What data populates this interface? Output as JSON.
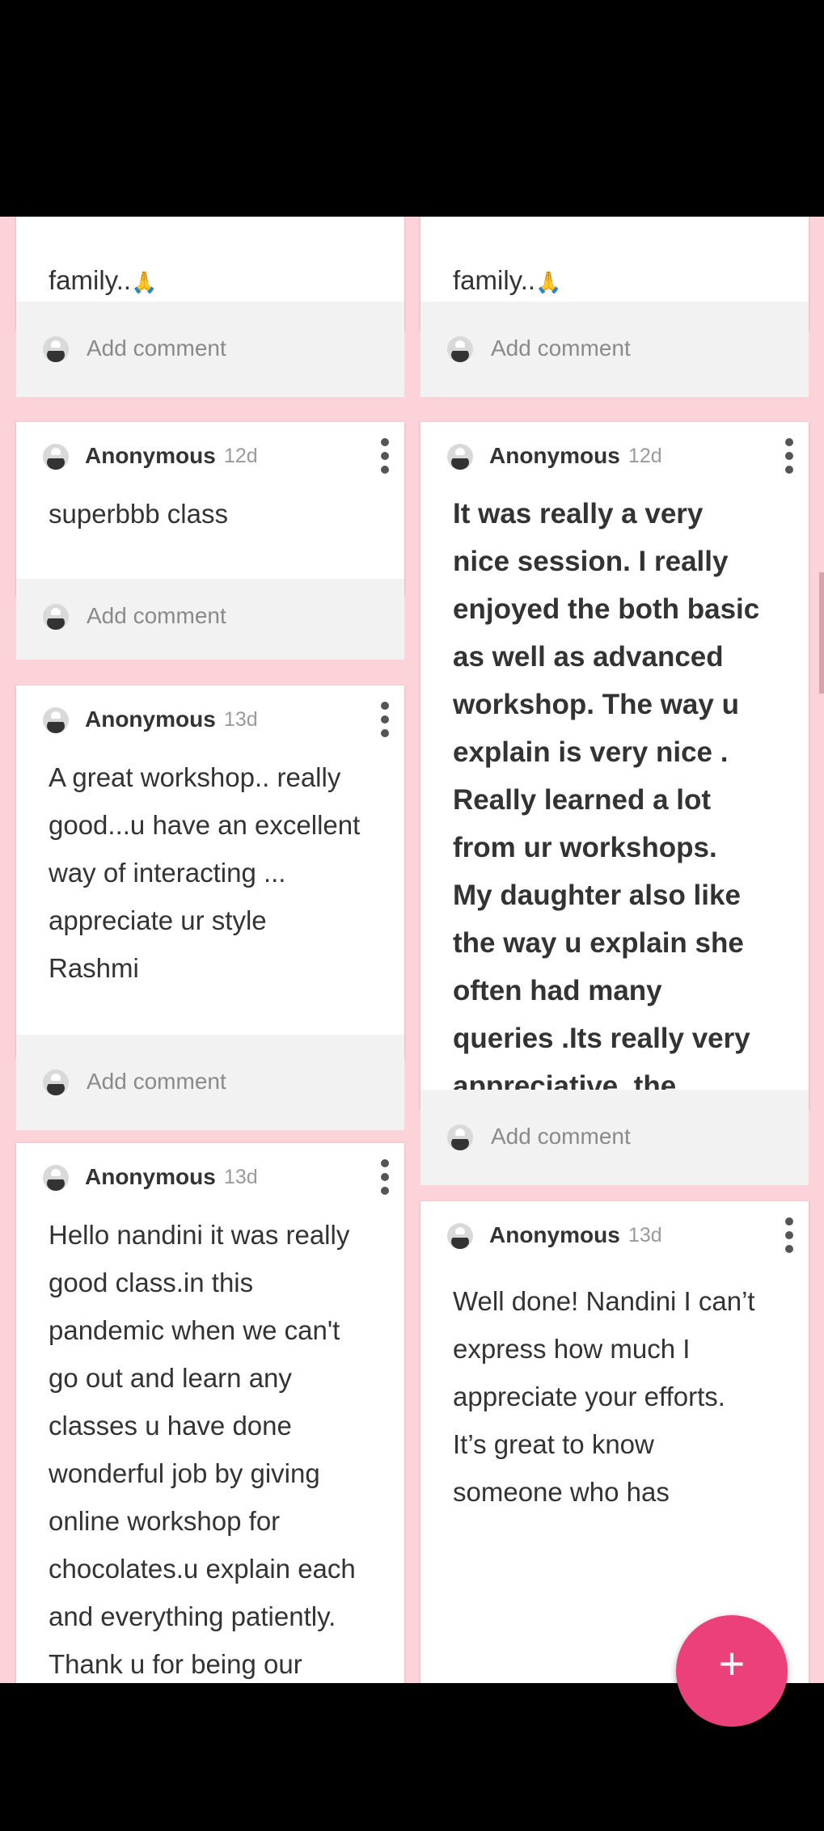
{
  "left_column": {
    "top_card": {
      "tail_text": "family..",
      "emoji": "🙏",
      "comment_label": "Add comment"
    },
    "cards": [
      {
        "author": "Anonymous",
        "age": "12d",
        "text": "superbbb class",
        "comment_label": "Add comment"
      },
      {
        "author": "Anonymous",
        "age": "13d",
        "text": "A great workshop.. really\ngood...u have an excellent\nway of interacting ...\nappreciate ur style\nRashmi",
        "comment_label": "Add comment"
      },
      {
        "author": "Anonymous",
        "age": "13d",
        "text": "Hello nandini it was really\ngood class.in this\npandemic when  we can't\ngo out and learn any\nclasses u have done\nwonderful job by giving\nonline workshop for\nchocolates.u explain each\nand everything patiently.\nThank u for being our"
      }
    ]
  },
  "right_column": {
    "top_card": {
      "tail_text": "family..",
      "emoji": "🙏",
      "comment_label": "Add comment"
    },
    "cards": [
      {
        "author": "Anonymous",
        "age": "12d",
        "text": "It was really a very\nnice session. I really\nenjoyed the both basic\nas well as advanced\nworkshop. The way u\nexplain is very nice .\nReally learned a lot\nfrom ur workshops.\nMy daughter also like\nthe way u explain she\noften had many\nqueries .Its really very\nappreciative ,the\nefforts u for us in this\npandemic time.",
        "comment_label": "Add comment"
      },
      {
        "author": "Anonymous",
        "age": "13d",
        "text": "Well done! Nandini I can’t\nexpress how much I\nappreciate your efforts.\nIt’s great to know\nsomeone who has"
      }
    ]
  },
  "fab": {
    "label": "+"
  },
  "colors": {
    "board_bg": "#fbd3d9",
    "fab": "#ec407a",
    "comment_bar": "#f2f2f2"
  }
}
